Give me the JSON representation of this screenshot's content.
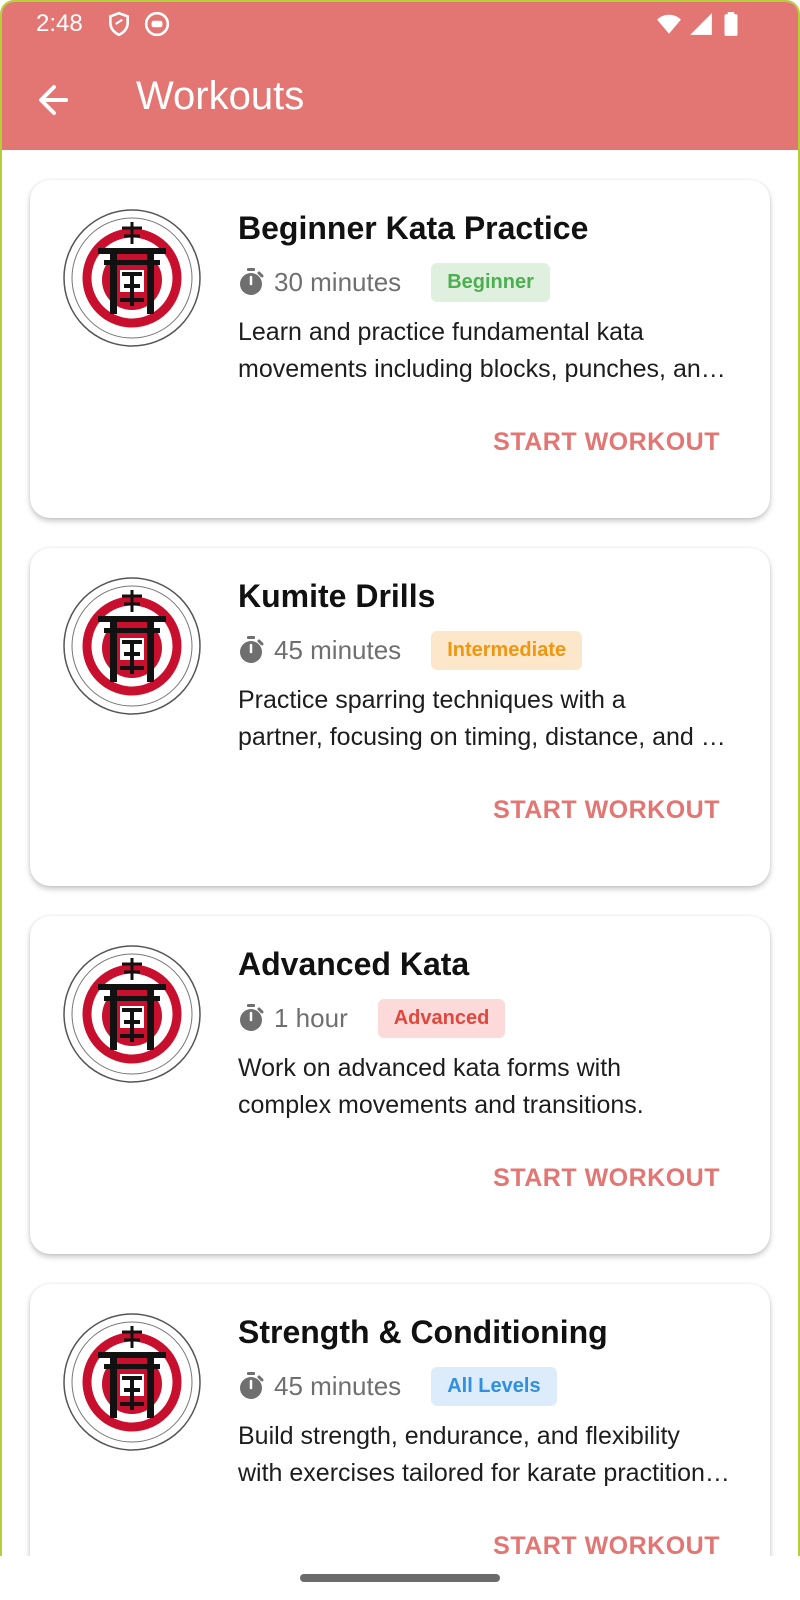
{
  "status_bar": {
    "time": "2:48",
    "left_icons": [
      "shield-icon",
      "face-icon"
    ],
    "right_icons": [
      "wifi-icon",
      "signal-icon",
      "battery-icon"
    ]
  },
  "header": {
    "title": "Workouts",
    "background_color": "#e37673",
    "back_icon": "arrow-left-icon"
  },
  "workouts": [
    {
      "title": "Beginner Kata Practice",
      "duration": "30 minutes",
      "level": "Beginner",
      "level_text_color": "#4caf50",
      "level_bg_color": "#dff0df",
      "description_lines": [
        "Learn and practice fundamental kata",
        "movements including blocks, punches, and kicks."
      ],
      "action": "START WORKOUT"
    },
    {
      "title": "Kumite Drills",
      "duration": "45 minutes",
      "level": "Intermediate",
      "level_text_color": "#f0960f",
      "level_bg_color": "#fde7cb",
      "description_lines": [
        "Practice sparring techniques with a",
        "partner, focusing on timing, distance, and control."
      ],
      "action": "START WORKOUT"
    },
    {
      "title": "Advanced Kata",
      "duration": "1 hour",
      "level": "Advanced",
      "level_text_color": "#e0483f",
      "level_bg_color": "#fcdada",
      "description_lines": [
        "Work on advanced kata forms with",
        "complex movements and transitions."
      ],
      "action": "START WORKOUT"
    },
    {
      "title": "Strength & Conditioning",
      "duration": "45 minutes",
      "level": "All Levels",
      "level_text_color": "#2f8fe0",
      "level_bg_color": "#dcecfb",
      "description_lines": [
        "Build strength, endurance, and flexibility",
        "with exercises tailored for karate practitioners."
      ],
      "action": "START WORKOUT"
    }
  ],
  "icons": {
    "timer": "timer-icon",
    "logo": "zen-karate-logo"
  }
}
